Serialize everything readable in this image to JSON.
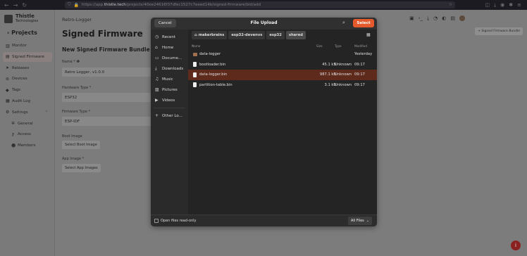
{
  "browser": {
    "url_prefix": "https://app.",
    "url_domain": "thistle.tech",
    "url_path": "/projects/40ee24616f37dfec1527c7eeed14b/signed-firmware/bid/add"
  },
  "sidebar": {
    "logo_line1": "Thistle",
    "logo_line2": "Technologies",
    "projects_label": "Projects",
    "items": [
      {
        "label": "Monitor",
        "icon": "chart-icon"
      },
      {
        "label": "Signed Firmware",
        "icon": "firmware-icon"
      },
      {
        "label": "Releases",
        "icon": "send-icon"
      },
      {
        "label": "Devices",
        "icon": "device-icon"
      },
      {
        "label": "Tags",
        "icon": "tag-icon"
      },
      {
        "label": "Audit Log",
        "icon": "log-icon"
      },
      {
        "label": "Settings",
        "icon": "settings-icon"
      },
      {
        "label": "General",
        "icon": "gear-icon"
      },
      {
        "label": "Access",
        "icon": "key-icon"
      },
      {
        "label": "Members",
        "icon": "members-icon"
      }
    ]
  },
  "main": {
    "breadcrumb": "Retro-Logger",
    "title": "Signed Firmware",
    "subtitle": "New Signed Firmware Bundle",
    "name_label": "Name",
    "name_value": "Retro Logger, v1.0.0",
    "hardware_label": "Hardware Type",
    "hardware_value": "ESP32",
    "firmware_label": "Firmware Type",
    "firmware_value": "ESP-IDF",
    "boot_label": "Boot Image",
    "boot_button": "Select Boot Image",
    "app_label": "App Image",
    "app_button": "Select App Images",
    "bundle_button": "+ Signed Firmware Bundle",
    "fab_icon": "i"
  },
  "dialog": {
    "cancel": "Cancel",
    "title": "File Upload",
    "select": "Select",
    "places": [
      {
        "label": "Recent",
        "icon": "clock-icon"
      },
      {
        "label": "Home",
        "icon": "home-icon"
      },
      {
        "label": "Docume...",
        "icon": "document-icon"
      },
      {
        "label": "Downloads",
        "icon": "download-icon"
      },
      {
        "label": "Music",
        "icon": "music-icon"
      },
      {
        "label": "Pictures",
        "icon": "picture-icon"
      },
      {
        "label": "Videos",
        "icon": "video-icon"
      }
    ],
    "other_locations": "Other Lo...",
    "path": [
      "makerbrains",
      "esp32-devenvs",
      "esp32",
      "shared"
    ],
    "columns": {
      "name": "Name",
      "size": "Size",
      "type": "Type",
      "modified": "Modified"
    },
    "files": [
      {
        "name": "data-logger",
        "size": "",
        "type": "",
        "modified": "Yesterday",
        "folder": true
      },
      {
        "name": "bootloader.bin",
        "size": "45.1 kB",
        "type": "Unknown",
        "modified": "09:17"
      },
      {
        "name": "data-logger.bin",
        "size": "987.1 kB",
        "type": "Unknown",
        "modified": "09:17"
      },
      {
        "name": "partition-table.bin",
        "size": "3.1 kB",
        "type": "Unknown",
        "modified": "09:17"
      }
    ],
    "open_readonly": "Open files read-only",
    "filter": "All Files"
  }
}
